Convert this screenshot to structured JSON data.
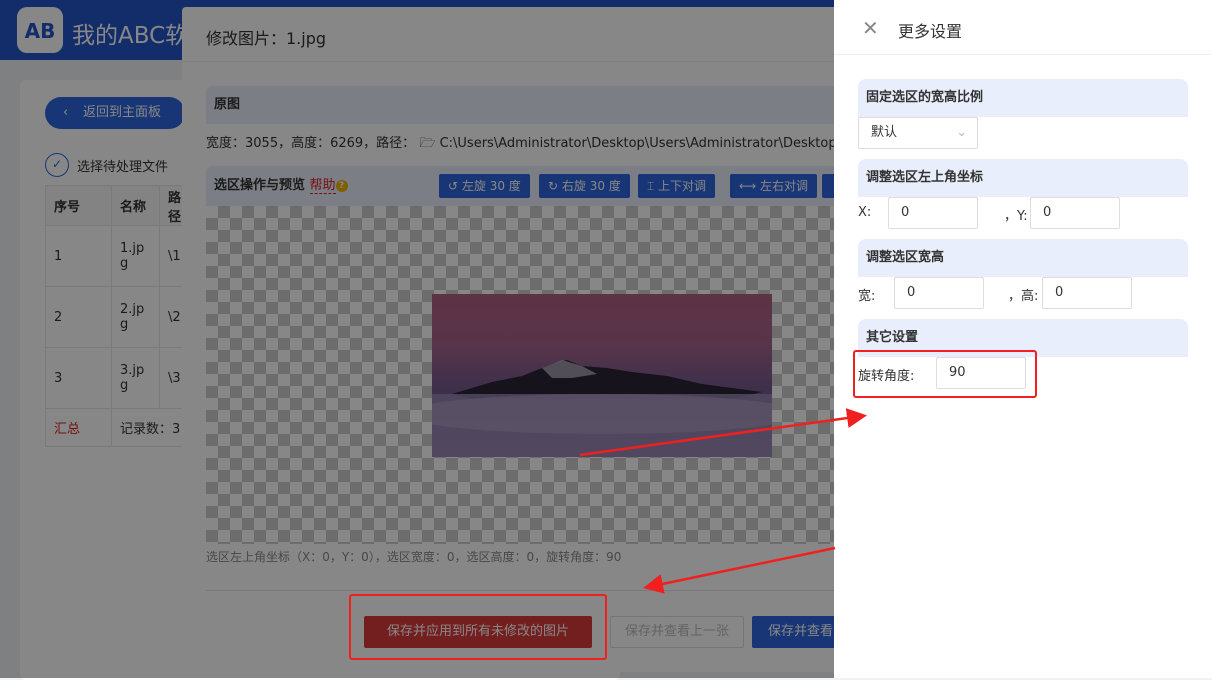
{
  "app": {
    "logo": "AB",
    "title": "我的ABC软件工具箱"
  },
  "bg": {
    "back": "返回到主面板",
    "step": "选择待处理文件",
    "headers": [
      "序号",
      "名称",
      "路径"
    ],
    "rows": [
      [
        "1",
        "1.jp g",
        "\\1"
      ],
      [
        "2",
        "2.jp g",
        "\\2"
      ],
      [
        "3",
        "3.jp g",
        "\\3"
      ]
    ],
    "summary": [
      "汇总",
      "记录数：3"
    ]
  },
  "dialog": {
    "title": "修改图片：1.jpg",
    "orig_section": "原图",
    "info": "宽度：3055，高度：6269，路径：",
    "path": "C:\\Users\\Administrator\\Desktop\\Users\\Administrator\\Desktop\\",
    "preview_section": "选区操作与预览",
    "help": "帮助",
    "tools": [
      "左旋 30 度",
      "右旋 30 度",
      "上下对调",
      "左右对调"
    ],
    "status": "选区左上角坐标（X：0，Y：0），选区宽度：0，选区高度：0，旋转角度：90",
    "btn_apply_all": "保存并应用到所有未修改的图片",
    "btn_prev": "保存并查看上一张",
    "btn_next": "保存并查看下一张"
  },
  "drawer": {
    "title": "更多设置",
    "ratio_section": "固定选区的宽高比例",
    "ratio_value": "默认",
    "coord_section": "调整选区左上角坐标",
    "x_label": "X:",
    "x": "0",
    "y_label": "，Y:",
    "y": "0",
    "size_section": "调整选区宽高",
    "w_label": "宽:",
    "w": "0",
    "h_label": "，高:",
    "h": "0",
    "other_section": "其它设置",
    "rotate_label": "旋转角度:",
    "rotate": "90"
  },
  "colors": {
    "primary": "#2f66de",
    "danger": "#dc3c3c",
    "annotation": "#f02020"
  }
}
